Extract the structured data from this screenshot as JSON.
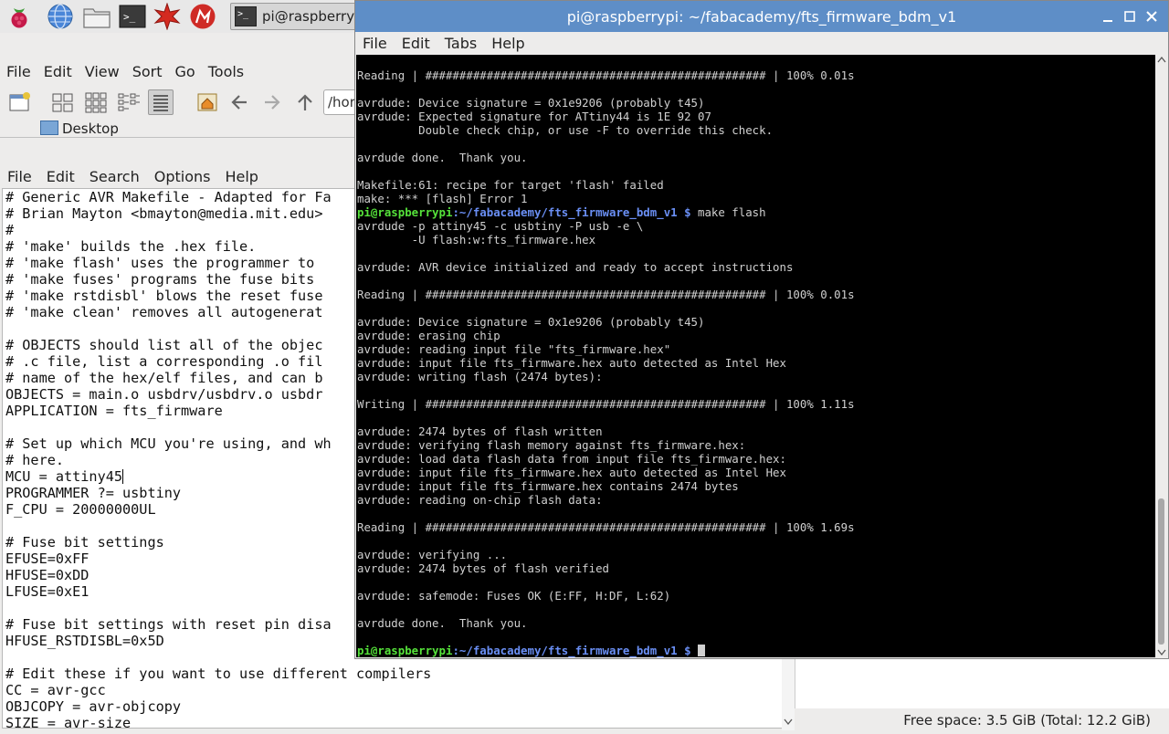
{
  "taskbar": {
    "icons": [
      "raspberry-menu-icon",
      "web-browser-icon",
      "file-manager-icon",
      "terminal-icon",
      "mathematica-icon",
      "wolfram-icon"
    ],
    "task_label": "pi@raspberryp"
  },
  "file_manager": {
    "menu": [
      "File",
      "Edit",
      "View",
      "Sort",
      "Go",
      "Tools"
    ],
    "path_value": "/hor",
    "sidebar_item": "Desktop",
    "status_text": "Free space: 3.5 GiB (Total: 12.2 GiB)"
  },
  "editor": {
    "menu": [
      "File",
      "Edit",
      "Search",
      "Options",
      "Help"
    ],
    "lines": [
      "# Generic AVR Makefile - Adapted for Fa",
      "# Brian Mayton <bmayton@media.mit.edu>",
      "#",
      "# 'make' builds the .hex file.",
      "# 'make flash' uses the programmer to",
      "# 'make fuses' programs the fuse bits",
      "# 'make rstdisbl' blows the reset fuse",
      "# 'make clean' removes all autogenerat",
      "",
      "# OBJECTS should list all of the objec",
      "# .c file, list a corresponding .o fil",
      "# name of the hex/elf files, and can b",
      "OBJECTS = main.o usbdrv/usbdrv.o usbdr",
      "APPLICATION = fts_firmware",
      "",
      "# Set up which MCU you're using, and wh",
      "# here.",
      "MCU = attiny45",
      "PROGRAMMER ?= usbtiny",
      "F_CPU = 20000000UL",
      "",
      "# Fuse bit settings",
      "EFUSE=0xFF",
      "HFUSE=0xDD",
      "LFUSE=0xE1",
      "",
      "# Fuse bit settings with reset pin disa",
      "HFUSE_RSTDISBL=0x5D",
      "",
      "# Edit these if you want to use different compilers",
      "CC = avr-gcc",
      "OBJCOPY = avr-objcopy",
      "SIZE = avr-size"
    ]
  },
  "terminal": {
    "title": "pi@raspberrypi: ~/fabacademy/fts_firmware_bdm_v1",
    "menu": [
      "File",
      "Edit",
      "Tabs",
      "Help"
    ],
    "prompt_user": "pi@raspberrypi",
    "prompt_path": ":~/fabacademy/fts_firmware_bdm_v1 $",
    "lines": [
      {
        "t": "Reading | ################################################## | 100% 0.01s"
      },
      {
        "t": ""
      },
      {
        "t": "avrdude: Device signature = 0x1e9206 (probably t45)"
      },
      {
        "t": "avrdude: Expected signature for ATtiny44 is 1E 92 07"
      },
      {
        "t": "         Double check chip, or use -F to override this check."
      },
      {
        "t": ""
      },
      {
        "t": "avrdude done.  Thank you."
      },
      {
        "t": ""
      },
      {
        "t": "Makefile:61: recipe for target 'flash' failed"
      },
      {
        "t": "make: *** [flash] Error 1"
      },
      {
        "prompt": true,
        "cmd": " make flash"
      },
      {
        "t": "avrdude -p attiny45 -c usbtiny -P usb -e \\"
      },
      {
        "t": "        -U flash:w:fts_firmware.hex"
      },
      {
        "t": ""
      },
      {
        "t": "avrdude: AVR device initialized and ready to accept instructions"
      },
      {
        "t": ""
      },
      {
        "t": "Reading | ################################################## | 100% 0.01s"
      },
      {
        "t": ""
      },
      {
        "t": "avrdude: Device signature = 0x1e9206 (probably t45)"
      },
      {
        "t": "avrdude: erasing chip"
      },
      {
        "t": "avrdude: reading input file \"fts_firmware.hex\""
      },
      {
        "t": "avrdude: input file fts_firmware.hex auto detected as Intel Hex"
      },
      {
        "t": "avrdude: writing flash (2474 bytes):"
      },
      {
        "t": ""
      },
      {
        "t": "Writing | ################################################## | 100% 1.11s"
      },
      {
        "t": ""
      },
      {
        "t": "avrdude: 2474 bytes of flash written"
      },
      {
        "t": "avrdude: verifying flash memory against fts_firmware.hex:"
      },
      {
        "t": "avrdude: load data flash data from input file fts_firmware.hex:"
      },
      {
        "t": "avrdude: input file fts_firmware.hex auto detected as Intel Hex"
      },
      {
        "t": "avrdude: input file fts_firmware.hex contains 2474 bytes"
      },
      {
        "t": "avrdude: reading on-chip flash data:"
      },
      {
        "t": ""
      },
      {
        "t": "Reading | ################################################## | 100% 1.69s"
      },
      {
        "t": ""
      },
      {
        "t": "avrdude: verifying ..."
      },
      {
        "t": "avrdude: 2474 bytes of flash verified"
      },
      {
        "t": ""
      },
      {
        "t": "avrdude: safemode: Fuses OK (E:FF, H:DF, L:62)"
      },
      {
        "t": ""
      },
      {
        "t": "avrdude done.  Thank you."
      },
      {
        "t": ""
      },
      {
        "prompt": true,
        "cmd": " ",
        "cursor": true
      }
    ]
  }
}
